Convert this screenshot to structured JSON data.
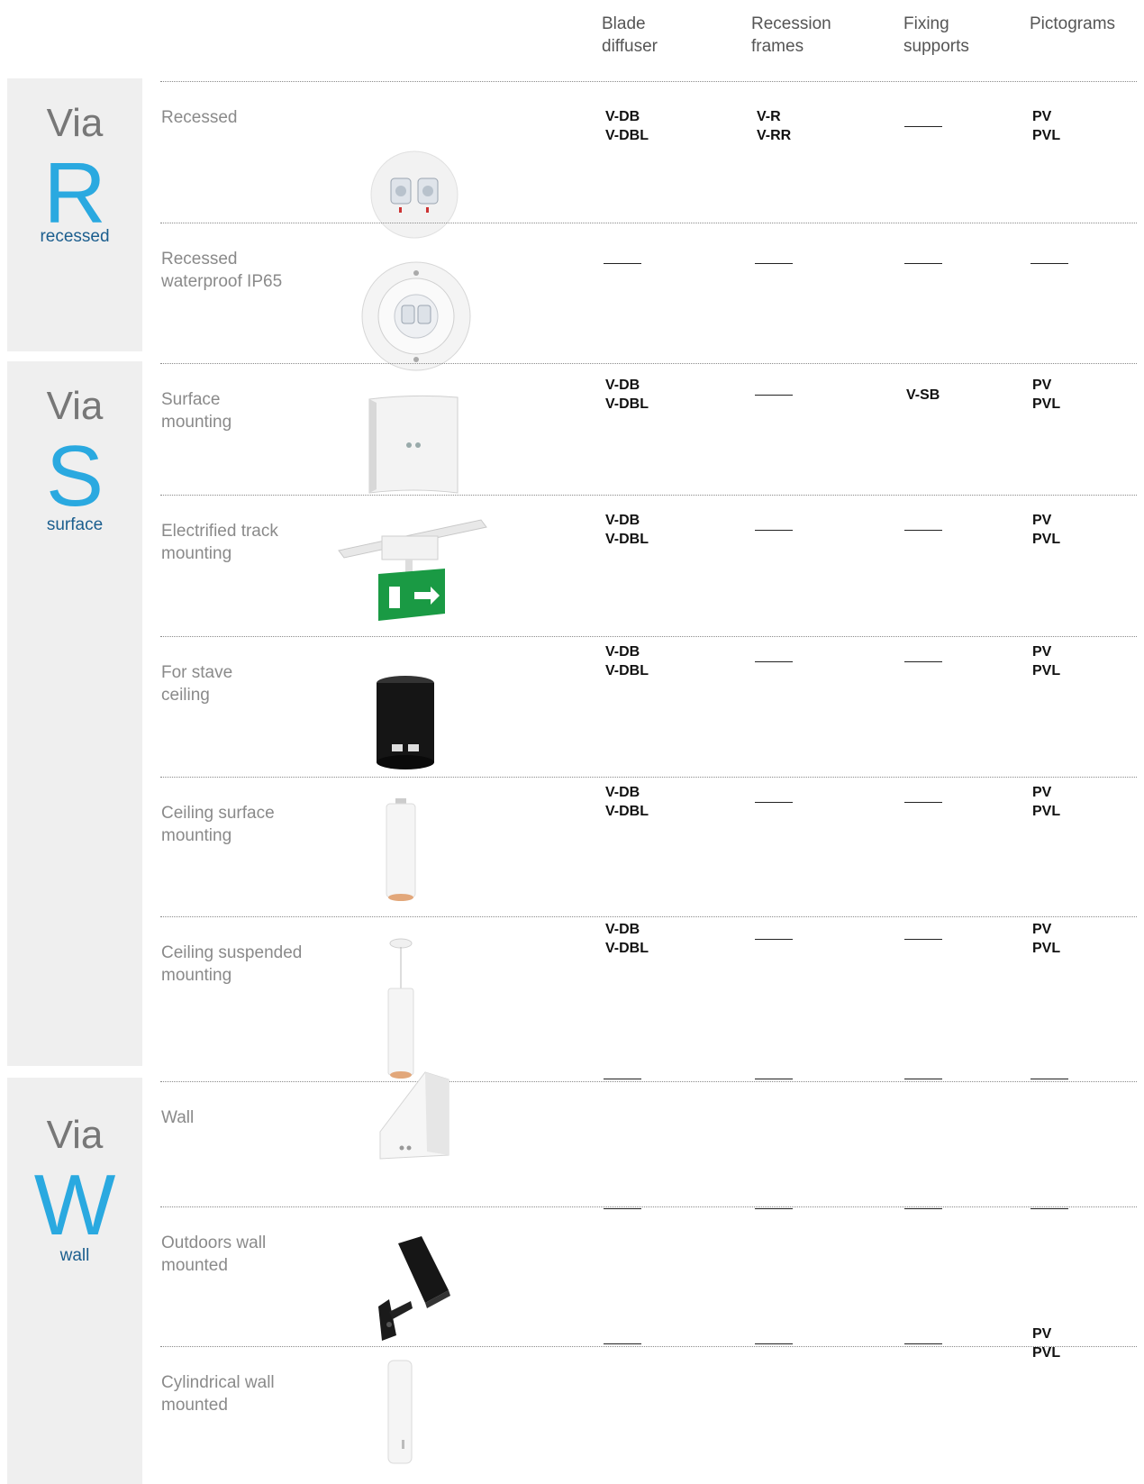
{
  "columns": [
    "Blade\ndiffuser",
    "Recession\nframes",
    "Fixing\nsupports",
    "Pictograms"
  ],
  "groups": [
    {
      "via": "Via",
      "letter": "R",
      "label": "recessed"
    },
    {
      "via": "Via",
      "letter": "S",
      "label": "surface"
    },
    {
      "via": "Via",
      "letter": "W",
      "label": "wall"
    }
  ],
  "rows": [
    {
      "label": "Recessed",
      "product_icon": "recessed-round-light-icon",
      "blade": "V-DB\nV-DBL",
      "frames": "V-R\nV-RR",
      "fixing": "—",
      "pictograms": "PV\nPVL"
    },
    {
      "label": "Recessed\nwaterproof IP65",
      "product_icon": "recessed-waterproof-light-icon",
      "blade": "—",
      "frames": "—",
      "fixing": "—",
      "pictograms": "—"
    },
    {
      "label": "Surface\nmounting",
      "product_icon": "surface-box-light-icon",
      "blade": "V-DB\nV-DBL",
      "frames": "—",
      "fixing": "V-SB",
      "pictograms": "PV\nPVL"
    },
    {
      "label": "Electrified track\nmounting",
      "product_icon": "track-exit-sign-icon",
      "blade": "V-DB\nV-DBL",
      "frames": "—",
      "fixing": "—",
      "pictograms": "PV\nPVL"
    },
    {
      "label": "For stave\nceiling",
      "product_icon": "black-cylinder-light-icon",
      "blade": "V-DB\nV-DBL",
      "frames": "—",
      "fixing": "—",
      "pictograms": "PV\nPVL"
    },
    {
      "label": "Ceiling surface\nmounting",
      "product_icon": "white-cylinder-light-icon",
      "blade": "V-DB\nV-DBL",
      "frames": "—",
      "fixing": "—",
      "pictograms": "PV\nPVL"
    },
    {
      "label": "Ceiling suspended\nmounting",
      "product_icon": "suspended-cylinder-light-icon",
      "blade": "V-DB\nV-DBL",
      "frames": "—",
      "fixing": "—",
      "pictograms": "PV\nPVL"
    },
    {
      "label": "Wall",
      "product_icon": "wall-wedge-light-icon",
      "blade": "—",
      "frames": "—",
      "fixing": "—",
      "pictograms": "—"
    },
    {
      "label": "Outdoors wall\nmounted",
      "product_icon": "outdoor-wall-spot-icon",
      "blade": "—",
      "frames": "—",
      "fixing": "—",
      "pictograms": "—"
    },
    {
      "label": "Cylindrical wall\nmounted",
      "product_icon": "wall-cylinder-light-icon",
      "blade": "—",
      "frames": "—",
      "fixing": "—",
      "pictograms": "PV\nPVL"
    }
  ],
  "colors": {
    "accent": "#2aa9e0",
    "sub_label": "#1b5e8e",
    "panel": "#efefef",
    "exit_green": "#1a9a44"
  }
}
